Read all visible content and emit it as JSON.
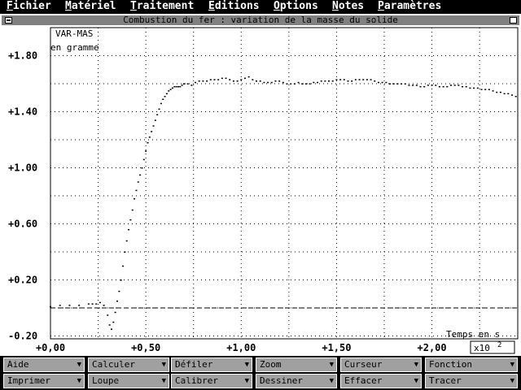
{
  "menu": [
    {
      "first": "F",
      "rest": "ichier"
    },
    {
      "first": "M",
      "rest": "atériel"
    },
    {
      "first": "T",
      "rest": "raitement"
    },
    {
      "first": "E",
      "rest": "ditions"
    },
    {
      "first": "O",
      "rest": "ptions"
    },
    {
      "first": "N",
      "rest": "otes"
    },
    {
      "first": "P",
      "rest": "aramètres"
    }
  ],
  "window": {
    "title": "Combustion du fer : variation de la masse du solide"
  },
  "toolbar": {
    "row1": [
      "Aide",
      "Calculer",
      "Défiler",
      "Zoom",
      "Curseur",
      "Fonction"
    ],
    "row2": [
      "Imprimer",
      "Loupe",
      "Calibrer",
      "Dessiner",
      "Effacer",
      "Tracer"
    ]
  },
  "chart_data": {
    "type": "scatter",
    "title": "Combustion du fer : variation de la masse du solide",
    "ylabel": "VAR-MAS",
    "ylabel_unit": "en gramme",
    "xlabel": "Temps en s",
    "x_multiplier_label": "x10",
    "x_multiplier_exp": "2",
    "xlim": [
      0,
      2.45
    ],
    "ylim": [
      -0.22,
      2.0
    ],
    "grid": true,
    "y_ticks": [
      "+1.80",
      "+1.40",
      "+1.00",
      "+0.60",
      "+0.20",
      "-0.20"
    ],
    "y_tick_values": [
      1.8,
      1.4,
      1.0,
      0.6,
      0.2,
      -0.2
    ],
    "x_ticks": [
      "+0,00",
      "+0,50",
      "+1,00",
      "+1,50",
      "+2,00"
    ],
    "x_tick_values": [
      0,
      0.5,
      1.0,
      1.5,
      2.0
    ],
    "y_minor_values": [
      2.0,
      1.6,
      1.2,
      0.8,
      0.4,
      0.0
    ],
    "x_minor_values": [
      0.25,
      0.75,
      1.25,
      1.75,
      2.25
    ],
    "reference_line_y": 0.0,
    "series": [
      {
        "x": [
          0.0,
          0.05,
          0.1,
          0.15,
          0.2,
          0.22,
          0.24,
          0.26,
          0.28,
          0.3,
          0.31,
          0.32,
          0.33,
          0.34,
          0.35,
          0.36,
          0.37,
          0.38,
          0.39,
          0.4,
          0.41,
          0.42,
          0.43,
          0.44,
          0.45,
          0.46,
          0.47,
          0.48,
          0.49,
          0.5,
          0.51,
          0.52,
          0.53,
          0.54,
          0.55,
          0.56,
          0.57,
          0.58,
          0.59,
          0.6,
          0.61,
          0.62,
          0.63,
          0.64,
          0.65,
          0.66,
          0.67,
          0.68,
          0.69,
          0.7,
          0.72,
          0.74,
          0.76,
          0.78,
          0.8,
          0.82,
          0.84,
          0.86,
          0.88,
          0.9,
          0.92,
          0.94,
          0.96,
          0.98,
          1.0,
          1.02,
          1.04,
          1.06,
          1.08,
          1.1,
          1.12,
          1.14,
          1.16,
          1.18,
          1.2,
          1.22,
          1.24,
          1.26,
          1.28,
          1.3,
          1.32,
          1.34,
          1.36,
          1.38,
          1.4,
          1.42,
          1.44,
          1.46,
          1.48,
          1.5,
          1.52,
          1.54,
          1.56,
          1.58,
          1.6,
          1.62,
          1.64,
          1.66,
          1.68,
          1.7,
          1.72,
          1.74,
          1.76,
          1.78,
          1.8,
          1.82,
          1.84,
          1.86,
          1.88,
          1.9,
          1.92,
          1.94,
          1.96,
          1.98,
          2.0,
          2.02,
          2.04,
          2.06,
          2.08,
          2.1,
          2.12,
          2.14,
          2.16,
          2.18,
          2.2,
          2.22,
          2.24,
          2.26,
          2.28,
          2.3,
          2.32,
          2.34,
          2.36,
          2.38,
          2.4,
          2.42,
          2.44
        ],
        "y": [
          0.01,
          0.02,
          0.02,
          0.02,
          0.03,
          0.03,
          0.03,
          0.04,
          0.02,
          -0.05,
          -0.12,
          -0.15,
          -0.1,
          -0.03,
          0.05,
          0.12,
          0.2,
          0.3,
          0.4,
          0.48,
          0.56,
          0.63,
          0.7,
          0.78,
          0.84,
          0.9,
          0.95,
          1.0,
          1.06,
          1.12,
          1.18,
          1.22,
          1.26,
          1.3,
          1.34,
          1.38,
          1.42,
          1.46,
          1.49,
          1.51,
          1.53,
          1.55,
          1.56,
          1.57,
          1.58,
          1.58,
          1.58,
          1.58,
          1.59,
          1.6,
          1.6,
          1.59,
          1.61,
          1.62,
          1.62,
          1.62,
          1.63,
          1.63,
          1.63,
          1.64,
          1.64,
          1.63,
          1.62,
          1.62,
          1.63,
          1.64,
          1.65,
          1.63,
          1.62,
          1.62,
          1.61,
          1.61,
          1.61,
          1.62,
          1.62,
          1.61,
          1.6,
          1.6,
          1.6,
          1.61,
          1.6,
          1.6,
          1.6,
          1.61,
          1.61,
          1.62,
          1.62,
          1.62,
          1.62,
          1.63,
          1.63,
          1.63,
          1.62,
          1.62,
          1.63,
          1.63,
          1.63,
          1.63,
          1.63,
          1.62,
          1.61,
          1.61,
          1.61,
          1.6,
          1.6,
          1.6,
          1.6,
          1.6,
          1.59,
          1.59,
          1.59,
          1.58,
          1.58,
          1.59,
          1.59,
          1.59,
          1.58,
          1.58,
          1.58,
          1.59,
          1.59,
          1.59,
          1.58,
          1.58,
          1.57,
          1.57,
          1.57,
          1.56,
          1.56,
          1.56,
          1.55,
          1.54,
          1.54,
          1.53,
          1.53,
          1.52,
          1.51
        ]
      }
    ]
  }
}
